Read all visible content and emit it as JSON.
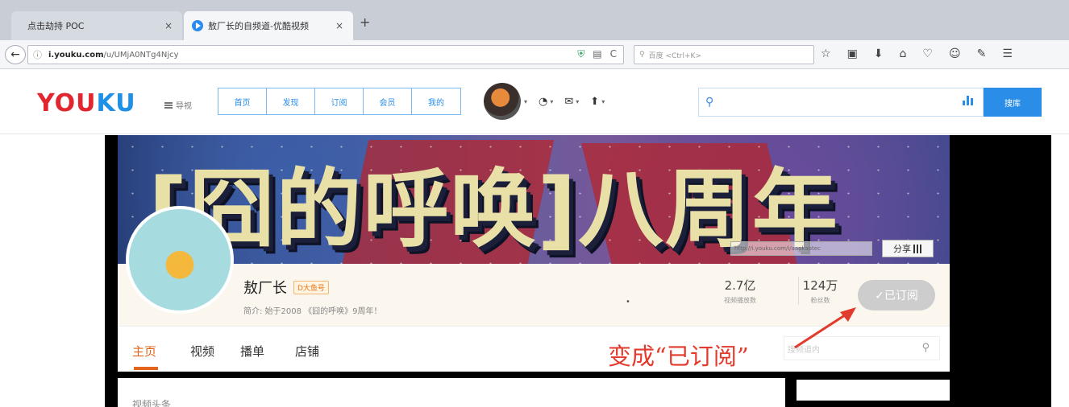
{
  "browser": {
    "tabs": [
      {
        "title": "点击劫持 POC",
        "close": "×"
      },
      {
        "title": "敖厂长的自频道-优酷视频",
        "close": "×"
      }
    ],
    "new_tab": "+",
    "back": "←",
    "info_icon": "ⓘ",
    "url_host": "i.youku.com",
    "url_path": "/u/UMjA0NTg4Njcy",
    "reload": "C",
    "search_placeholder": "百度 <Ctrl+K>",
    "toolbar_icons": [
      "☆",
      "▣",
      "⬇",
      "⌂",
      "♡",
      "☺",
      "✎",
      "☰"
    ]
  },
  "youku_header": {
    "logo_you": "YOU",
    "logo_ku": "KU",
    "category_label": "导视",
    "nav": [
      "首页",
      "发现",
      "订阅",
      "会员",
      "我的"
    ],
    "user_icons": [
      "◔",
      "✉",
      "⬆"
    ],
    "search_icon": "⚲",
    "search_button": "搜库"
  },
  "channel": {
    "banner_title": "[囧的呼唤]八周年",
    "banner_url": "http://i.youku.com/i/aaokaotec",
    "share_label": "分享",
    "name": "敖厂长",
    "badge": "D大鱼号",
    "intro": "简介: 始于2008 《囧的呼唤》9周年！",
    "dot": "•",
    "stats": [
      {
        "value": "2.7亿",
        "label": "视频播放数"
      },
      {
        "value": "124万",
        "label": "粉丝数"
      }
    ],
    "subscribed_button": "✓已订阅",
    "tabs": [
      "主页",
      "视频",
      "播单",
      "店铺"
    ],
    "search_placeholder": "搜频道内",
    "search_icon": "⚲"
  },
  "annotation": {
    "text": "变成“已订阅”",
    "color": "#e23a2c"
  },
  "content_heading": "视频头条",
  "colors": {
    "youku_red": "#e2262f",
    "youku_blue": "#1e90e5",
    "accent_orange": "#e3641c"
  }
}
